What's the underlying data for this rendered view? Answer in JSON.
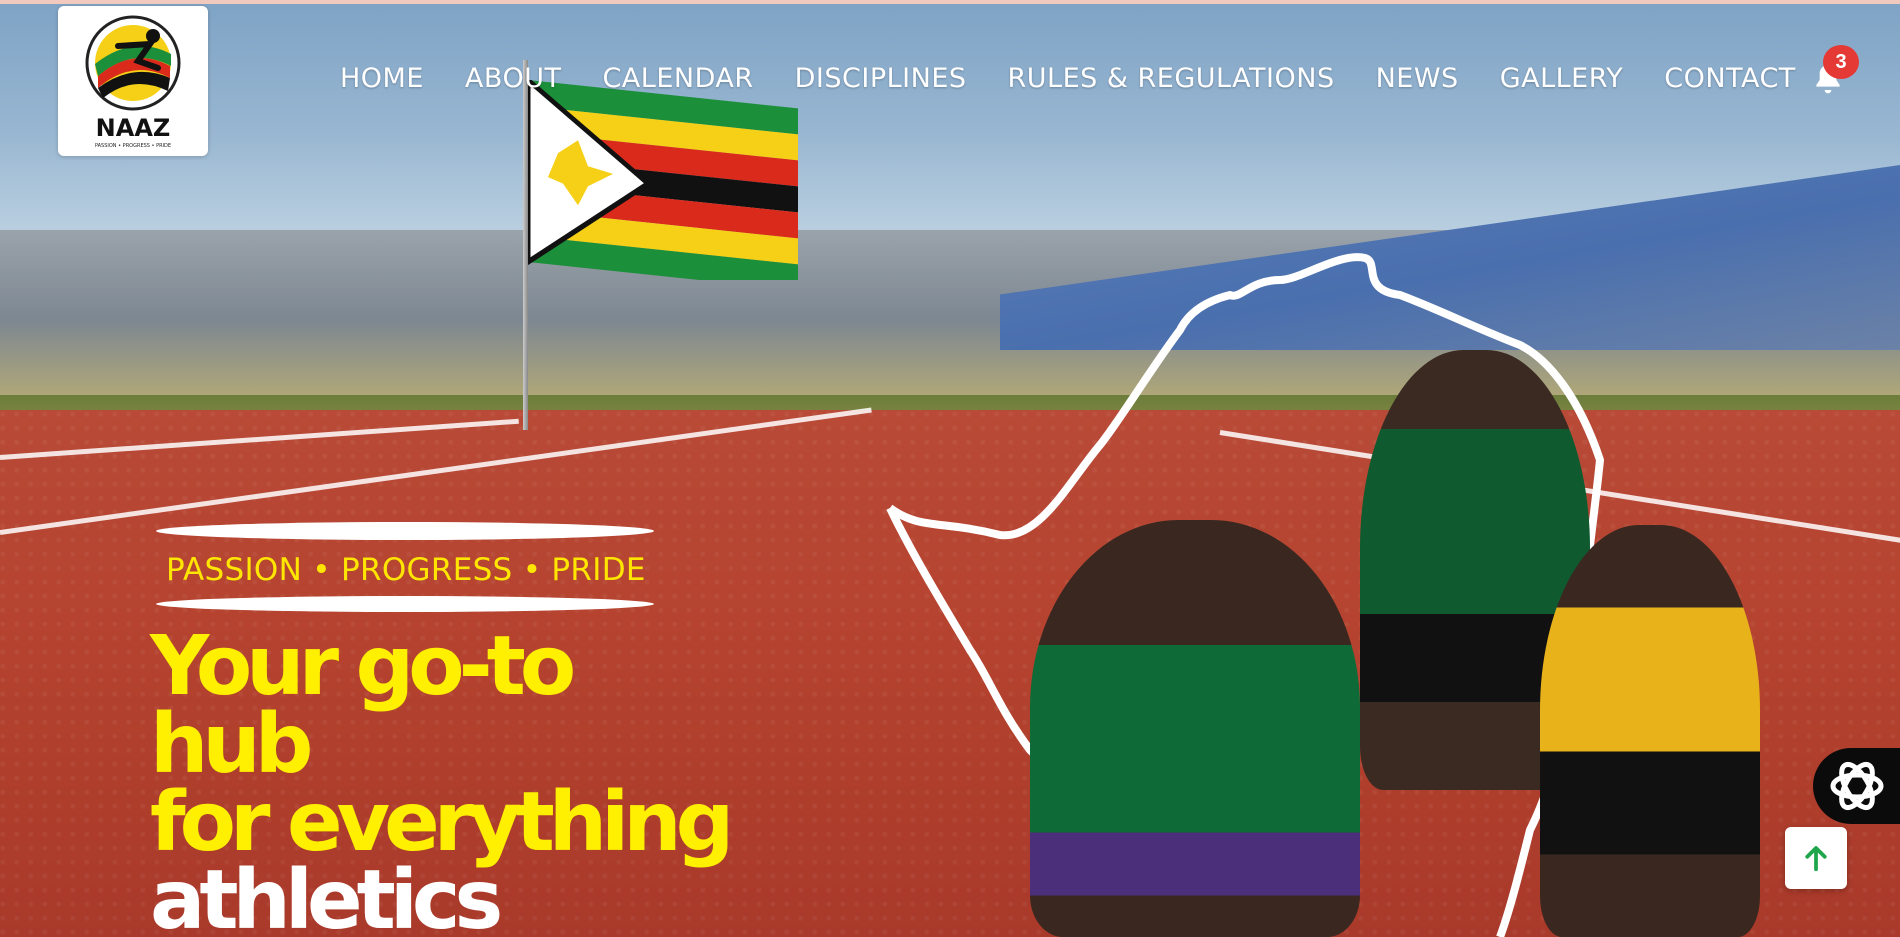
{
  "brand": {
    "logo_text": "NAAZ",
    "logo_sub": "PASSION • PROGRESS • PRIDE"
  },
  "nav": {
    "items": [
      {
        "label": "HOME"
      },
      {
        "label": "ABOUT"
      },
      {
        "label": "CALENDAR"
      },
      {
        "label": "DISCIPLINES"
      },
      {
        "label": "RULES & REGULATIONS"
      },
      {
        "label": "NEWS"
      },
      {
        "label": "GALLERY"
      },
      {
        "label": "CONTACT"
      }
    ]
  },
  "notifications": {
    "count": "3",
    "icon": "bell-icon"
  },
  "hero": {
    "tagline": "PASSION • PROGRESS • PRIDE",
    "headline_line1": "Your go-to hub",
    "headline_line2": "for everything",
    "headline_line3": "athletics"
  },
  "widgets": {
    "chat_icon": "chat-assistant-icon",
    "scroll_top_icon": "arrow-up-icon"
  },
  "colors": {
    "accent_yellow": "#ffef00",
    "badge_red": "#e53935",
    "scroll_arrow_green": "#1fa64a"
  }
}
